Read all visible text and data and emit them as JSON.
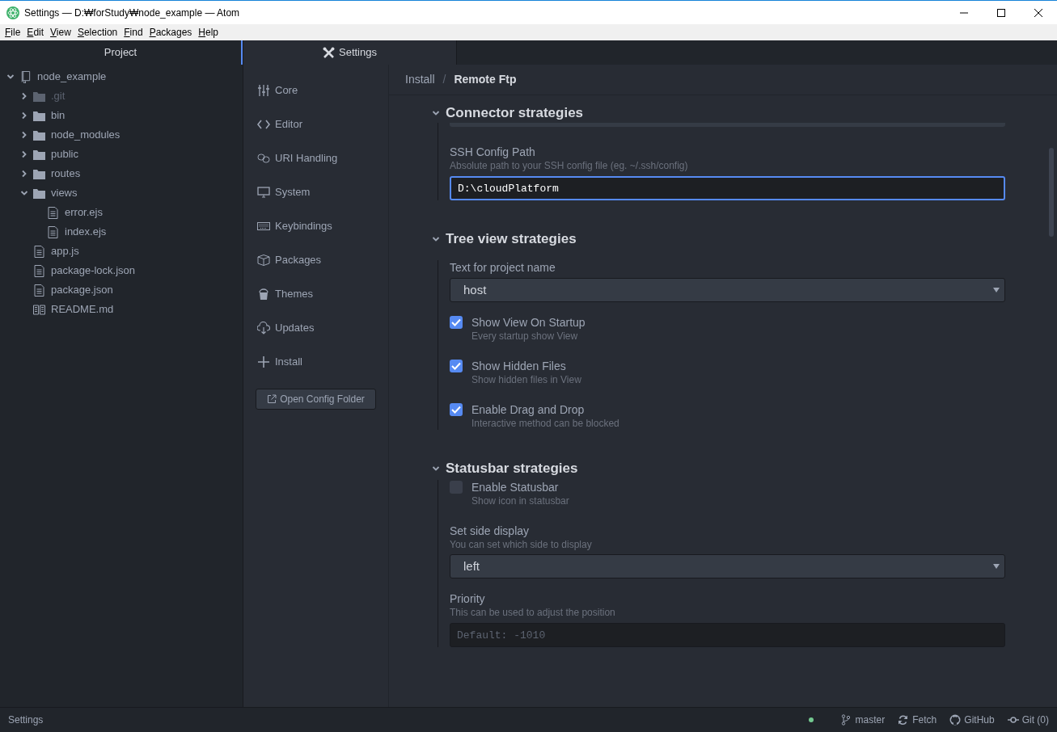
{
  "window": {
    "title": "Settings — D:₩forStudy₩node_example — Atom"
  },
  "menu": [
    "File",
    "Edit",
    "View",
    "Selection",
    "Find",
    "Packages",
    "Help"
  ],
  "tree_panel": {
    "title": "Project",
    "items": [
      {
        "label": "node_example",
        "kind": "repo",
        "expanded": true,
        "dimmed": false,
        "children": [
          {
            "label": ".git",
            "kind": "folder",
            "expanded": false,
            "dimmed": true
          },
          {
            "label": "bin",
            "kind": "folder",
            "expanded": false,
            "dimmed": false
          },
          {
            "label": "node_modules",
            "kind": "folder",
            "expanded": false,
            "dimmed": false
          },
          {
            "label": "public",
            "kind": "folder",
            "expanded": false,
            "dimmed": false
          },
          {
            "label": "routes",
            "kind": "folder",
            "expanded": false,
            "dimmed": false
          },
          {
            "label": "views",
            "kind": "folder",
            "expanded": true,
            "dimmed": false,
            "children": [
              {
                "label": "error.ejs",
                "kind": "file",
                "dimmed": false
              },
              {
                "label": "index.ejs",
                "kind": "file",
                "dimmed": false
              }
            ]
          },
          {
            "label": "app.js",
            "kind": "file",
            "dimmed": false
          },
          {
            "label": "package-lock.json",
            "kind": "file",
            "dimmed": false
          },
          {
            "label": "package.json",
            "kind": "file",
            "dimmed": false
          },
          {
            "label": "README.md",
            "kind": "readme",
            "dimmed": false
          }
        ]
      }
    ]
  },
  "tab": {
    "label": "Settings",
    "selected": true
  },
  "settings_nav": {
    "items": [
      {
        "label": "Core",
        "selected": false
      },
      {
        "label": "Editor",
        "selected": false
      },
      {
        "label": "URI Handling",
        "selected": false
      },
      {
        "label": "System",
        "selected": false
      },
      {
        "label": "Keybindings",
        "selected": false
      },
      {
        "label": "Packages",
        "selected": false
      },
      {
        "label": "Themes",
        "selected": false
      },
      {
        "label": "Updates",
        "selected": false
      },
      {
        "label": "Install",
        "selected": false
      }
    ],
    "button": "Open Config Folder"
  },
  "breadcrumb": {
    "separator": "/",
    "items": [
      {
        "label": "Install",
        "current": false
      },
      {
        "label": "Remote Ftp",
        "current": true
      }
    ]
  },
  "sections": [
    {
      "title": "Connector strategies",
      "expanded": true,
      "settings": [
        {
          "kind": "cut-off"
        },
        {
          "kind": "text",
          "label": "SSH Config Path",
          "description": "Absolute path to your SSH config file (eg. ~/.ssh/config)",
          "value": "D:\\cloudPlatform",
          "focused": true
        }
      ]
    },
    {
      "title": "Tree view strategies",
      "expanded": true,
      "settings": [
        {
          "kind": "select",
          "label": "Text for project name",
          "value": "host"
        },
        {
          "kind": "checkbox",
          "label": "Show View On Startup",
          "description": "Every startup show View",
          "checked": true
        },
        {
          "kind": "checkbox",
          "label": "Show Hidden Files",
          "description": "Show hidden files in View",
          "checked": true
        },
        {
          "kind": "checkbox",
          "label": "Enable Drag and Drop",
          "description": "Interactive method can be blocked",
          "checked": true
        }
      ]
    },
    {
      "title": "Statusbar strategies",
      "expanded": true,
      "settings": [
        {
          "kind": "checkbox",
          "label": "Enable Statusbar",
          "description": "Show icon in statusbar",
          "checked": false
        },
        {
          "kind": "select",
          "label": "Set side display",
          "description": "You can set which side to display",
          "value": "left"
        },
        {
          "kind": "text",
          "label": "Priority",
          "description": "This can be used to adjust the position",
          "placeholder": "Default: -1010",
          "focused": false
        }
      ]
    }
  ],
  "status_bar": {
    "left": "Settings",
    "items": [
      {
        "label": "master"
      },
      {
        "label": "Fetch"
      },
      {
        "label": "GitHub"
      },
      {
        "label": "Git (0)"
      }
    ]
  }
}
